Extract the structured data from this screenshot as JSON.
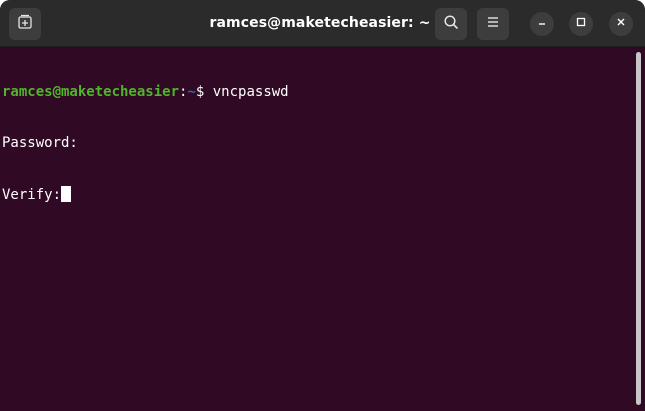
{
  "window": {
    "title": "ramces@maketecheasier: ~"
  },
  "titlebar": {
    "buttons": [
      "new-tab-icon",
      "search-icon",
      "hamburger-menu-icon",
      "minimize-icon",
      "maximize-icon",
      "close-icon"
    ]
  },
  "terminal": {
    "prompt_user_host": "ramces@maketecheasier",
    "prompt_colon": ":",
    "prompt_path": "~",
    "prompt_symbol": "$ ",
    "command": "vncpasswd",
    "output_line_1": "Password:",
    "output_line_2": "Verify:"
  },
  "colors": {
    "background": "#300a24",
    "titlebar": "#2b2b2b",
    "prompt_user": "#4fb52a",
    "prompt_path": "#3465a4",
    "text": "#ffffff"
  }
}
